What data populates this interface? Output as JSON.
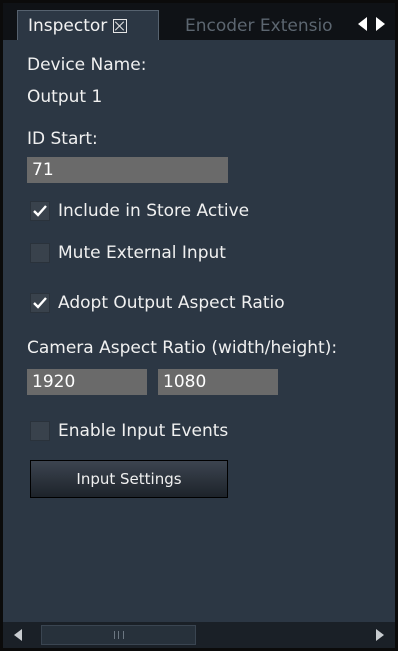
{
  "tabs": {
    "active_label": "Inspector",
    "inactive_label": "Encoder Extensio",
    "close_icon": "close-box-icon",
    "scroll_left_icon": "triangle-left-icon",
    "scroll_right_icon": "triangle-right-icon"
  },
  "inspector": {
    "device_name_label": "Device Name:",
    "device_name_value": "Output 1",
    "id_start_label": "ID Start:",
    "id_start_value": "71",
    "include_store_active": {
      "label": "Include in Store Active",
      "checked": true
    },
    "mute_external_input": {
      "label": "Mute External Input",
      "checked": false
    },
    "adopt_output_aspect": {
      "label": "Adopt Output Aspect Ratio",
      "checked": true
    },
    "camera_aspect_label": "Camera Aspect Ratio (width/height):",
    "camera_aspect_width": "1920",
    "camera_aspect_height": "1080",
    "enable_input_events": {
      "label": "Enable Input Events",
      "checked": false
    },
    "input_settings_button": "Input Settings"
  },
  "colors": {
    "panel_bg": "#2c3744",
    "field_bg": "#6a6a6a",
    "text": "#f0f0f0",
    "tab_strip": "#0f1216"
  }
}
